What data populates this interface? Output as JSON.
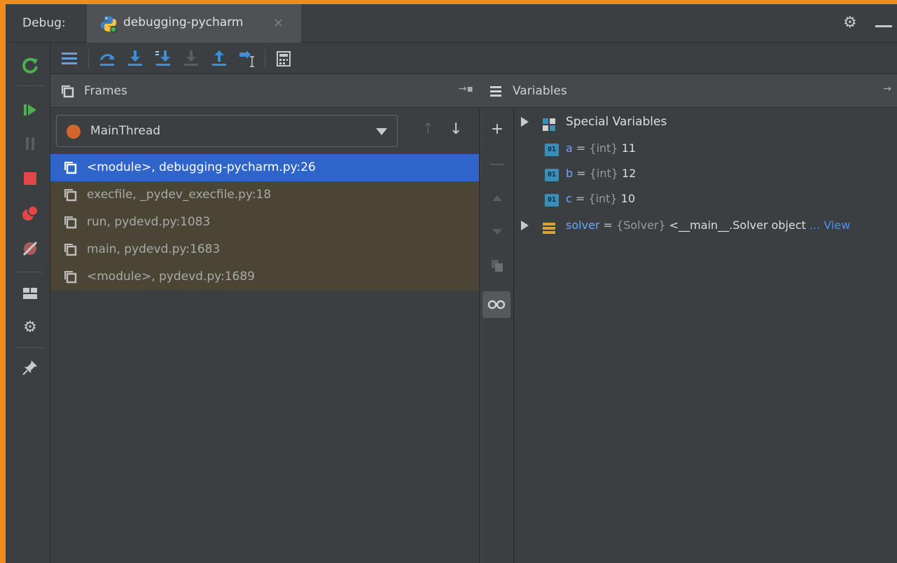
{
  "debug_bar": {
    "label": "Debug:",
    "tab_title": "debugging-pycharm",
    "close_glyph": "×"
  },
  "frames_panel": {
    "title": "Frames",
    "thread": "MainThread",
    "frames": [
      "<module>, debugging-pycharm.py:26",
      "execfile, _pydev_execfile.py:18",
      "run, pydevd.py:1083",
      "main, pydevd.py:1683",
      "<module>, pydevd.py:1689"
    ],
    "selected_index": 0
  },
  "variables_panel": {
    "title": "Variables",
    "special": "Special Variables",
    "badge": "01",
    "vars": [
      {
        "name": "a",
        "eq": " = ",
        "type": "{int}",
        "value": " 11"
      },
      {
        "name": "b",
        "eq": " = ",
        "type": "{int}",
        "value": " 12"
      },
      {
        "name": "c",
        "eq": " = ",
        "type": "{int}",
        "value": " 10"
      }
    ],
    "solver": {
      "name": "solver",
      "eq": " = ",
      "type": "{Solver}",
      "value": " <__main__.Solver object",
      "more": " ... View"
    }
  },
  "colors": {
    "accent_border": "#f08c1e",
    "selection": "#2f65ca",
    "frame_row_bg": "#4a4535",
    "var_name": "#6aa7ff"
  }
}
